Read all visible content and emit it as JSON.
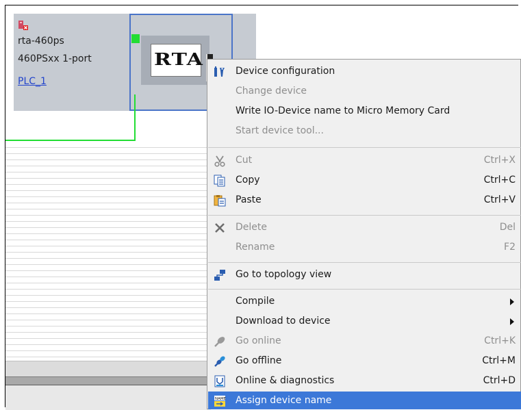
{
  "device": {
    "name": "rta-460ps",
    "type": "460PSxx 1-port",
    "controller_link": "PLC_1",
    "logo_text": "RTA"
  },
  "menu": {
    "items": [
      {
        "label": "Device configuration",
        "shortcut": "",
        "icon": "device-config-icon",
        "disabled": false
      },
      {
        "label": "Change device",
        "shortcut": "",
        "icon": "",
        "disabled": true
      },
      {
        "label": "Write IO-Device name to Micro Memory Card",
        "shortcut": "",
        "icon": "",
        "disabled": false
      },
      {
        "label": "Start device tool...",
        "shortcut": "",
        "icon": "",
        "disabled": true
      },
      {
        "label": "Cut",
        "shortcut": "Ctrl+X",
        "icon": "scissors-icon",
        "disabled": true
      },
      {
        "label": "Copy",
        "shortcut": "Ctrl+C",
        "icon": "copy-icon",
        "disabled": false
      },
      {
        "label": "Paste",
        "shortcut": "Ctrl+V",
        "icon": "paste-icon",
        "disabled": false
      },
      {
        "label": "Delete",
        "shortcut": "Del",
        "icon": "delete-x-icon",
        "disabled": true
      },
      {
        "label": "Rename",
        "shortcut": "F2",
        "icon": "",
        "disabled": true
      },
      {
        "label": "Go to topology view",
        "shortcut": "",
        "icon": "topology-icon",
        "disabled": false
      },
      {
        "label": "Compile",
        "shortcut": "",
        "icon": "",
        "disabled": false,
        "submenu": true
      },
      {
        "label": "Download to device",
        "shortcut": "",
        "icon": "",
        "disabled": false,
        "submenu": true
      },
      {
        "label": "Go online",
        "shortcut": "Ctrl+K",
        "icon": "go-online-icon",
        "disabled": true
      },
      {
        "label": "Go offline",
        "shortcut": "Ctrl+M",
        "icon": "go-offline-icon",
        "disabled": false
      },
      {
        "label": "Online & diagnostics",
        "shortcut": "Ctrl+D",
        "icon": "diagnostics-icon",
        "disabled": false
      },
      {
        "label": "Assign device name",
        "shortcut": "",
        "icon": "assign-name-icon",
        "disabled": false,
        "highlighted": true
      }
    ]
  },
  "colors": {
    "network_line": "#22dd33",
    "selection_border": "#4a74c8",
    "menu_highlight": "#3c78d8",
    "link": "#2244cc"
  }
}
